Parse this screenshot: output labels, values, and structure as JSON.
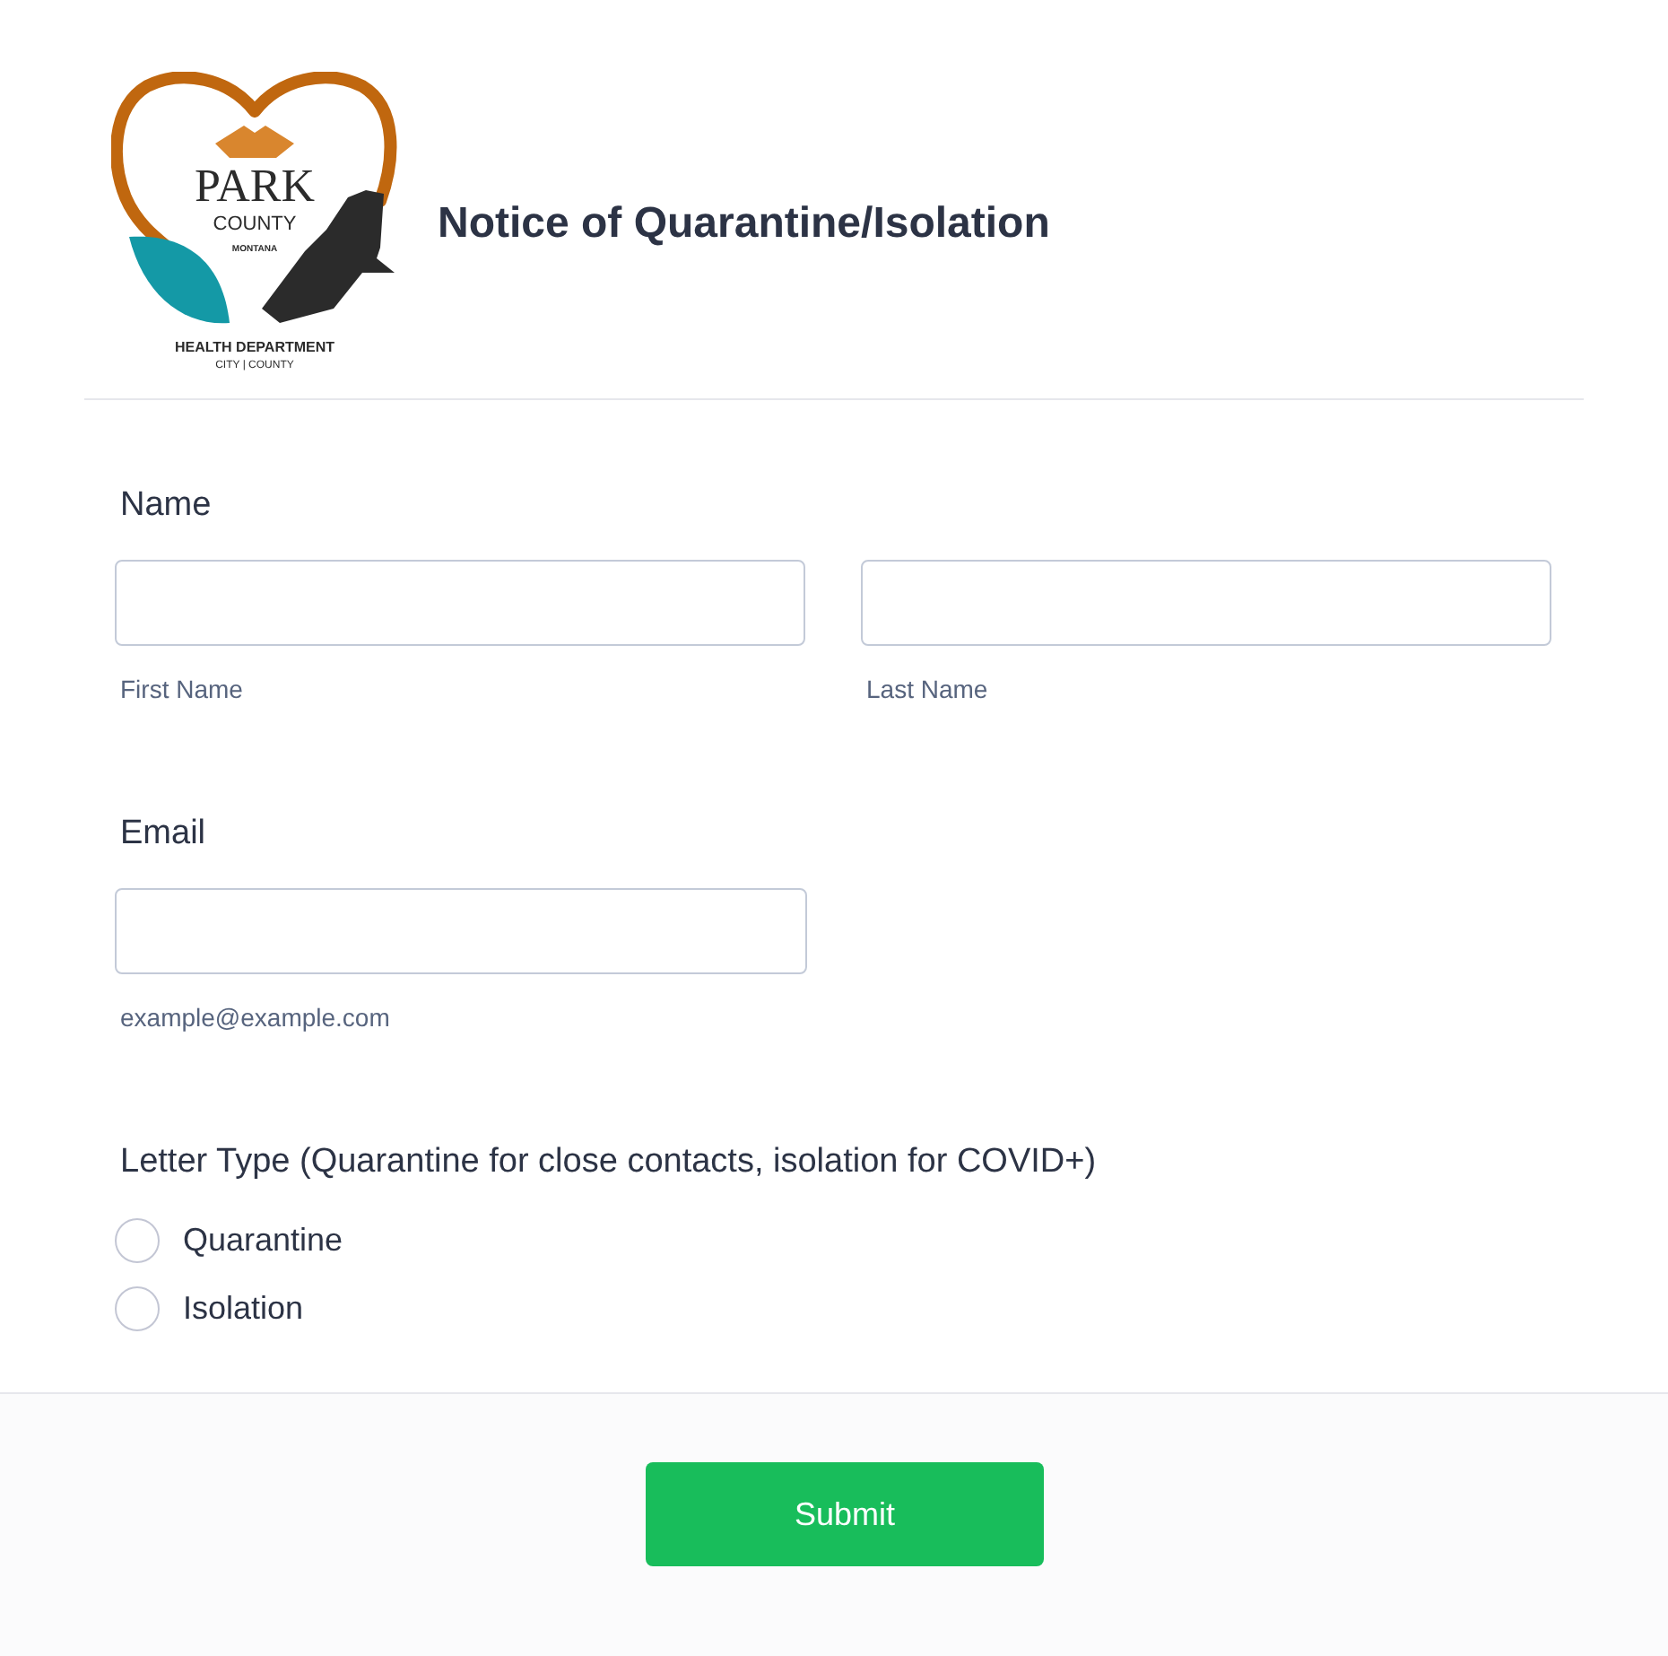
{
  "header": {
    "logo": {
      "name": "PARK",
      "county": "COUNTY",
      "state": "MONTANA",
      "department": "HEALTH DEPARTMENT",
      "jurisdiction": "CITY | COUNTY"
    },
    "title": "Notice of Quarantine/Isolation"
  },
  "fields": [
    {
      "kind": "text",
      "label": "Name",
      "inputs": [
        {
          "sublabel": "First Name"
        },
        {
          "sublabel": "Last Name"
        }
      ]
    },
    {
      "kind": "text",
      "label": "Email",
      "inputs": [
        {
          "sublabel": "example@example.com"
        }
      ]
    },
    {
      "kind": "radio",
      "label": "Letter Type (Quarantine for close contacts, isolation for COVID+)",
      "options": [
        {
          "label": "Quarantine",
          "selected": false
        },
        {
          "label": "Isolation",
          "selected": false
        }
      ]
    }
  ],
  "submit": {
    "label": "Submit"
  }
}
